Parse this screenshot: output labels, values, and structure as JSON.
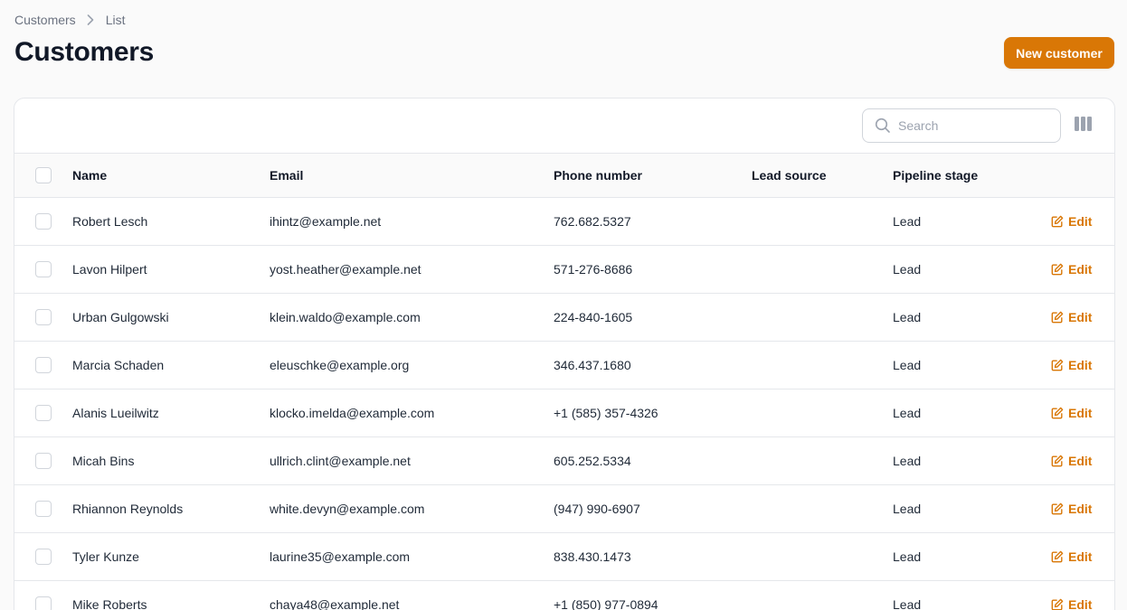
{
  "breadcrumb": {
    "root": "Customers",
    "current": "List"
  },
  "page": {
    "title": "Customers",
    "new_button": "New customer"
  },
  "search": {
    "placeholder": "Search",
    "value": ""
  },
  "colors": {
    "accent": "#d97706",
    "border": "#e5e7eb",
    "header_bg": "#fafafa"
  },
  "icons": {
    "breadcrumb_separator": "chevron-right-icon",
    "search": "search-icon",
    "column_toggle": "columns-icon",
    "edit": "pencil-square-icon"
  },
  "table": {
    "columns": {
      "name": "Name",
      "email": "Email",
      "phone": "Phone number",
      "lead_source": "Lead source",
      "pipeline_stage": "Pipeline stage"
    },
    "edit_label": "Edit",
    "rows": [
      {
        "name": "Robert Lesch",
        "email": "ihintz@example.net",
        "phone": "762.682.5327",
        "lead_source": "",
        "stage": "Lead"
      },
      {
        "name": "Lavon Hilpert",
        "email": "yost.heather@example.net",
        "phone": "571-276-8686",
        "lead_source": "",
        "stage": "Lead"
      },
      {
        "name": "Urban Gulgowski",
        "email": "klein.waldo@example.com",
        "phone": "224-840-1605",
        "lead_source": "",
        "stage": "Lead"
      },
      {
        "name": "Marcia Schaden",
        "email": "eleuschke@example.org",
        "phone": "346.437.1680",
        "lead_source": "",
        "stage": "Lead"
      },
      {
        "name": "Alanis Lueilwitz",
        "email": "klocko.imelda@example.com",
        "phone": "+1 (585) 357-4326",
        "lead_source": "",
        "stage": "Lead"
      },
      {
        "name": "Micah Bins",
        "email": "ullrich.clint@example.net",
        "phone": "605.252.5334",
        "lead_source": "",
        "stage": "Lead"
      },
      {
        "name": "Rhiannon Reynolds",
        "email": "white.devyn@example.com",
        "phone": "(947) 990-6907",
        "lead_source": "",
        "stage": "Lead"
      },
      {
        "name": "Tyler Kunze",
        "email": "laurine35@example.com",
        "phone": "838.430.1473",
        "lead_source": "",
        "stage": "Lead"
      },
      {
        "name": "Mike Roberts",
        "email": "chaya48@example.net",
        "phone": "+1 (850) 977-0894",
        "lead_source": "",
        "stage": "Lead"
      }
    ]
  }
}
